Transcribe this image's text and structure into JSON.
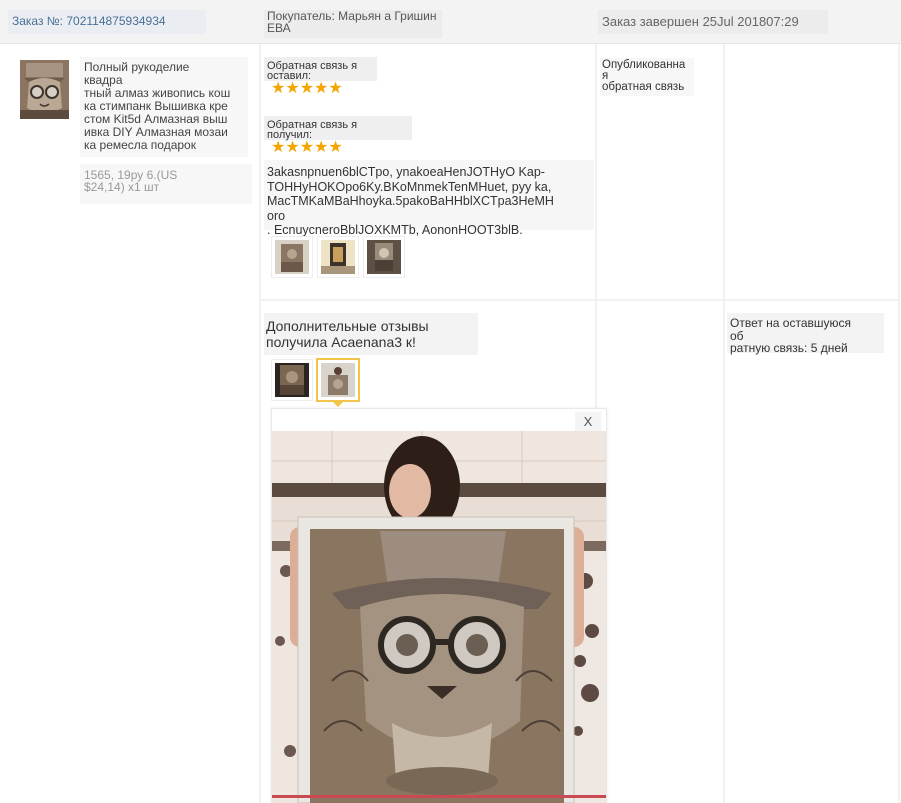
{
  "header": {
    "order_number": "Заказ №: 702114875934934",
    "buyer": "Покупатель: Марьян а Гришин\nЕВА",
    "status": "Заказ завершен 25Jul 201807:29"
  },
  "product": {
    "thumb_icon": "steampunk-cat-painting",
    "title": "Полный рукоделие\nквадра\nтный алмаз живопись кош\nка стимпанк Вышивка кре\nстом Kit5d Алмазная выш\nивка DIY Алмазная мозаи\nка ремесла подарок",
    "price": "1565, 19ру 6.(US\n$24,14) x1 шт"
  },
  "feedback": {
    "left_label": "Обратная связь я\nоставил:",
    "left_stars": "★★★★★",
    "received_label": "Обратная связь я\nполучил:",
    "received_stars": "★★★★★",
    "review_text": "3akasnpnuen6blCTpo, ynakoeaHenJOTHyO Kap-\nTOHHyHOKOpo6Ky.BKoMnmekTenMHuet, pyy ka,\nMacTMKaMBaHhoyka.5pakoBaHHblXCTpa3HeMH\noro\n. EcnuycneroBblJOXKMTb, AononHOOT3blB.",
    "photo_thumbs": [
      "review-photo-1",
      "review-photo-2",
      "review-photo-3"
    ],
    "published": "Опубликованна\nя\nобратная связь"
  },
  "additional": {
    "title": "Дополнительные отзывы\nполучила Acaenana3 к!",
    "photo_thumbs": [
      "additional-photo-1",
      "additional-photo-2"
    ],
    "remaining": "Ответ на оставшуюся\nоб\nратную связь: 5 дней"
  },
  "popup": {
    "close_label": "X",
    "photo": "woman-holding-steampunk-cat-diamond-painting"
  },
  "colors": {
    "order_link": "#4a6f95",
    "stars": "#f5a500",
    "active_thumb_border": "#f2c44a"
  }
}
